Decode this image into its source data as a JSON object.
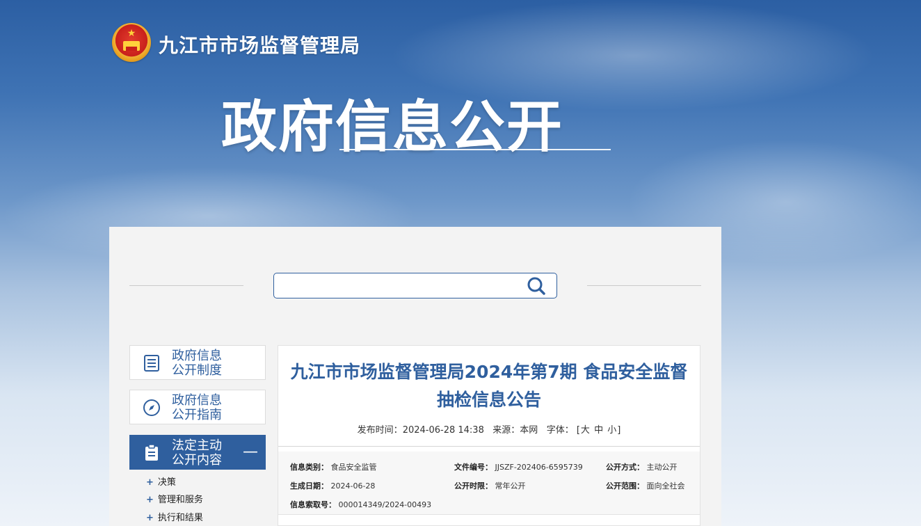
{
  "header": {
    "site_name": "九江市市场监督管理局",
    "hero_title": "政府信息公开"
  },
  "search": {
    "value": "",
    "placeholder": ""
  },
  "sidebar": {
    "items": [
      {
        "label_line1": "政府信息",
        "label_line2": "公开制度",
        "icon": "document-list-icon"
      },
      {
        "label_line1": "政府信息",
        "label_line2": "公开指南",
        "icon": "compass-icon"
      },
      {
        "label_line1": "法定主动",
        "label_line2": "公开内容",
        "icon": "clipboard-icon",
        "expanded_symbol": "—"
      }
    ],
    "sub_items": [
      "决策",
      "管理和服务",
      "执行和结果"
    ],
    "sub_prefix": "+"
  },
  "article": {
    "title": "九江市市场监督管理局2024年第7期 食品安全监督抽检信息公告",
    "publish_label": "发布时间：",
    "publish_time": "2024-06-28 14:38",
    "source_label": "来源：",
    "source": "本网",
    "font_label": "字体：",
    "font_open": "[",
    "font_large": "大",
    "font_medium": "中",
    "font_small": "小",
    "font_close": "]"
  },
  "info": {
    "category_label": "信息类别：",
    "category": "食品安全监管",
    "doc_no_label": "文件编号：",
    "doc_no": "JJSZF-202406-6595739",
    "method_label": "公开方式：",
    "method": "主动公开",
    "date_label": "生成日期：",
    "date": "2024-06-28",
    "period_label": "公开时限：",
    "period": "常年公开",
    "scope_label": "公开范围：",
    "scope": "面向全社会",
    "index_label": "信息索取号：",
    "index": "000014349/2024-00493"
  },
  "colors": {
    "brand_blue": "#2f5f9e",
    "panel_bg": "#f3f3f3"
  }
}
